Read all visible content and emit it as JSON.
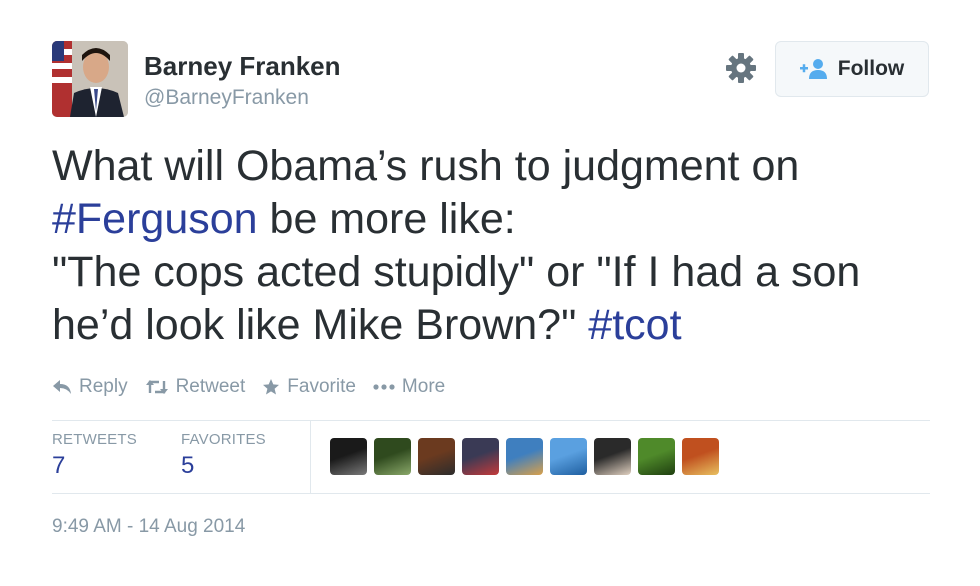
{
  "user": {
    "name": "Barney Franken",
    "handle": "@BarneyFranken"
  },
  "header": {
    "follow_label": "Follow"
  },
  "tweet": {
    "lines": [
      [
        "What will Obama’s rush to judgment on"
      ],
      [
        "#Ferguson",
        " be more like:"
      ],
      [
        "\"The cops acted stupidly\" or \"If I had a son"
      ],
      [
        "he’d look like Mike Brown?\" ",
        "#tcot"
      ]
    ],
    "hashtags": [
      "#Ferguson",
      "#tcot"
    ]
  },
  "actions": {
    "reply": "Reply",
    "retweet": "Retweet",
    "favorite": "Favorite",
    "more": "More"
  },
  "stats": {
    "retweets_label": "RETWEETS",
    "retweets_value": "7",
    "favorites_label": "FAVORITES",
    "favorites_value": "5"
  },
  "timestamp": "9:49 AM - 14 Aug 2014",
  "colors": {
    "hashtag": "#2b3f9a",
    "text": "#292f33",
    "muted": "#8899a6",
    "border": "#e1e8ed"
  },
  "favoriter_avatar_colors": [
    [
      "#1a1a1a",
      "#7a7a7a"
    ],
    [
      "#2f4a1e",
      "#8aa86a"
    ],
    [
      "#6b3a1f",
      "#2c2c2c"
    ],
    [
      "#3a3a55",
      "#c43a3a"
    ],
    [
      "#3f7fbf",
      "#d9a04a"
    ],
    [
      "#5aa0e0",
      "#1f5fa0"
    ],
    [
      "#2a2a2a",
      "#e0d0c0"
    ],
    [
      "#4f8a2a",
      "#1f3f10"
    ],
    [
      "#c0501f",
      "#e8c060"
    ]
  ]
}
